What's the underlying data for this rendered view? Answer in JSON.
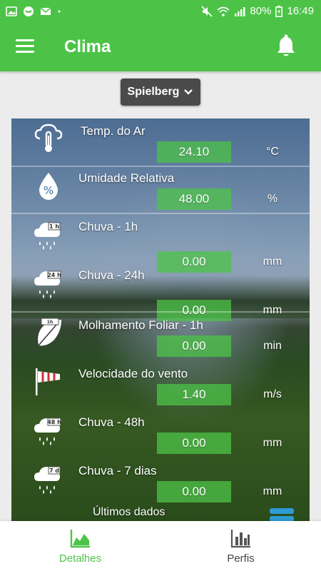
{
  "status_bar": {
    "battery": "80%",
    "time": "16:49"
  },
  "app_bar": {
    "title": "Clima"
  },
  "location": {
    "selected": "Spielberg"
  },
  "readings": [
    {
      "icon": "thermometer-cloud-icon",
      "label": "Temp. do Ar",
      "value": "24.10",
      "unit": "°C"
    },
    {
      "icon": "humidity-drop-icon",
      "label": "Umidade Relativa",
      "value": "48.00",
      "unit": "%"
    },
    {
      "icon": "rain-cloud-1h-icon",
      "label": "Chuva - 1h",
      "value": "0.00",
      "unit": "mm"
    },
    {
      "icon": "rain-cloud-24h-icon",
      "label": "Chuva - 24h",
      "value": "0.00",
      "unit": "mm"
    },
    {
      "icon": "leaf-wetness-icon",
      "label": "Molhamento Foliar - 1h",
      "value": "0.00",
      "unit": "min"
    },
    {
      "icon": "windsock-icon",
      "label": "Velocidade do vento",
      "value": "1.40",
      "unit": "m/s"
    },
    {
      "icon": "rain-cloud-48h-icon",
      "label": "Chuva - 48h",
      "value": "0.00",
      "unit": "mm"
    },
    {
      "icon": "rain-cloud-7d-icon",
      "label": "Chuva - 7 dias",
      "value": "0.00",
      "unit": "mm"
    }
  ],
  "footer_note": "Últimos dados",
  "bottom_nav": [
    {
      "label": "Detalhes",
      "icon": "area-chart-icon",
      "active": true
    },
    {
      "label": "Perfis",
      "icon": "bar-chart-icon",
      "active": false
    }
  ],
  "colors": {
    "primary": "#4cc347",
    "value_box": "#4cc347",
    "select_bg": "#4a4a4a"
  }
}
